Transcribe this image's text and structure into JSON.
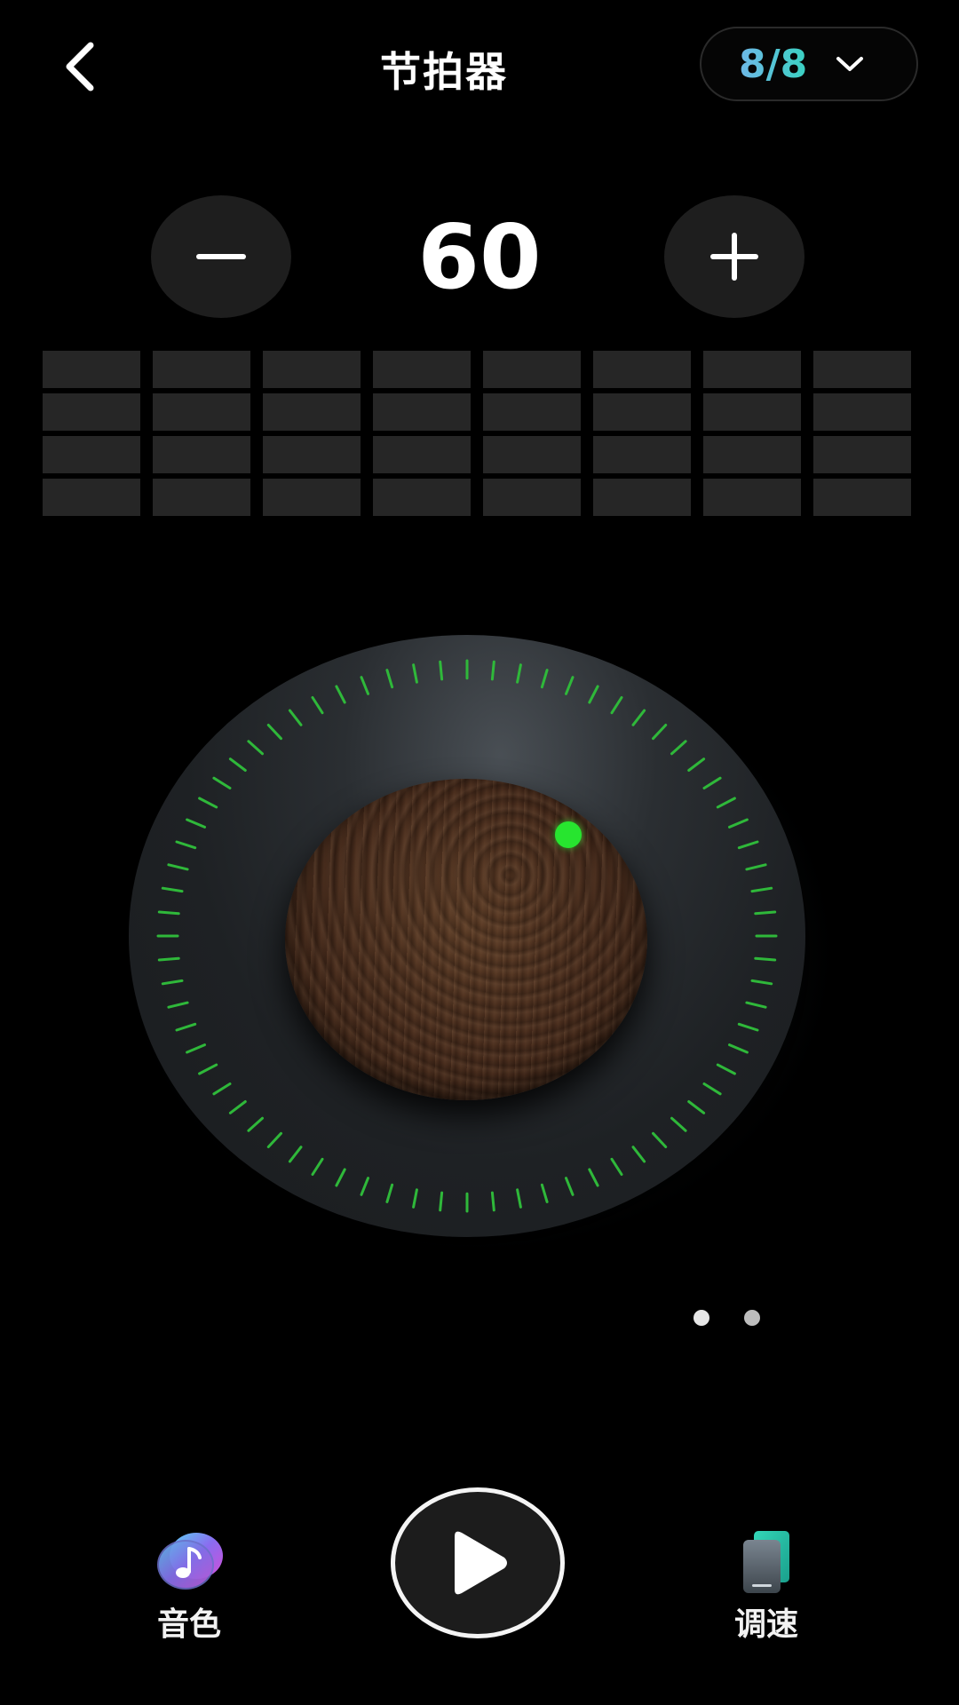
{
  "header": {
    "title": "节拍器",
    "back_icon": "chevron-left-icon",
    "time_signature": "8/8",
    "time_signature_icon": "chevron-down-icon",
    "signature_gradient": [
      "#6fb8e8",
      "#3ad1c2"
    ]
  },
  "tempo": {
    "bpm": "60",
    "decrease_icon": "minus-icon",
    "increase_icon": "plus-icon"
  },
  "beats": {
    "count": 8,
    "levels_per_beat": 4,
    "cell_color": "#262626"
  },
  "dial": {
    "tick_color": "#2fb83a",
    "indicator_color": "#27e52f",
    "knob_material": "wood"
  },
  "pager": {
    "pages": 2,
    "active": 1
  },
  "bottom_bar": {
    "tone_label": "音色",
    "tone_icon": "music-note-icon",
    "play_icon": "play-icon",
    "speed_label": "调速",
    "speed_icon": "tablet-icon"
  }
}
